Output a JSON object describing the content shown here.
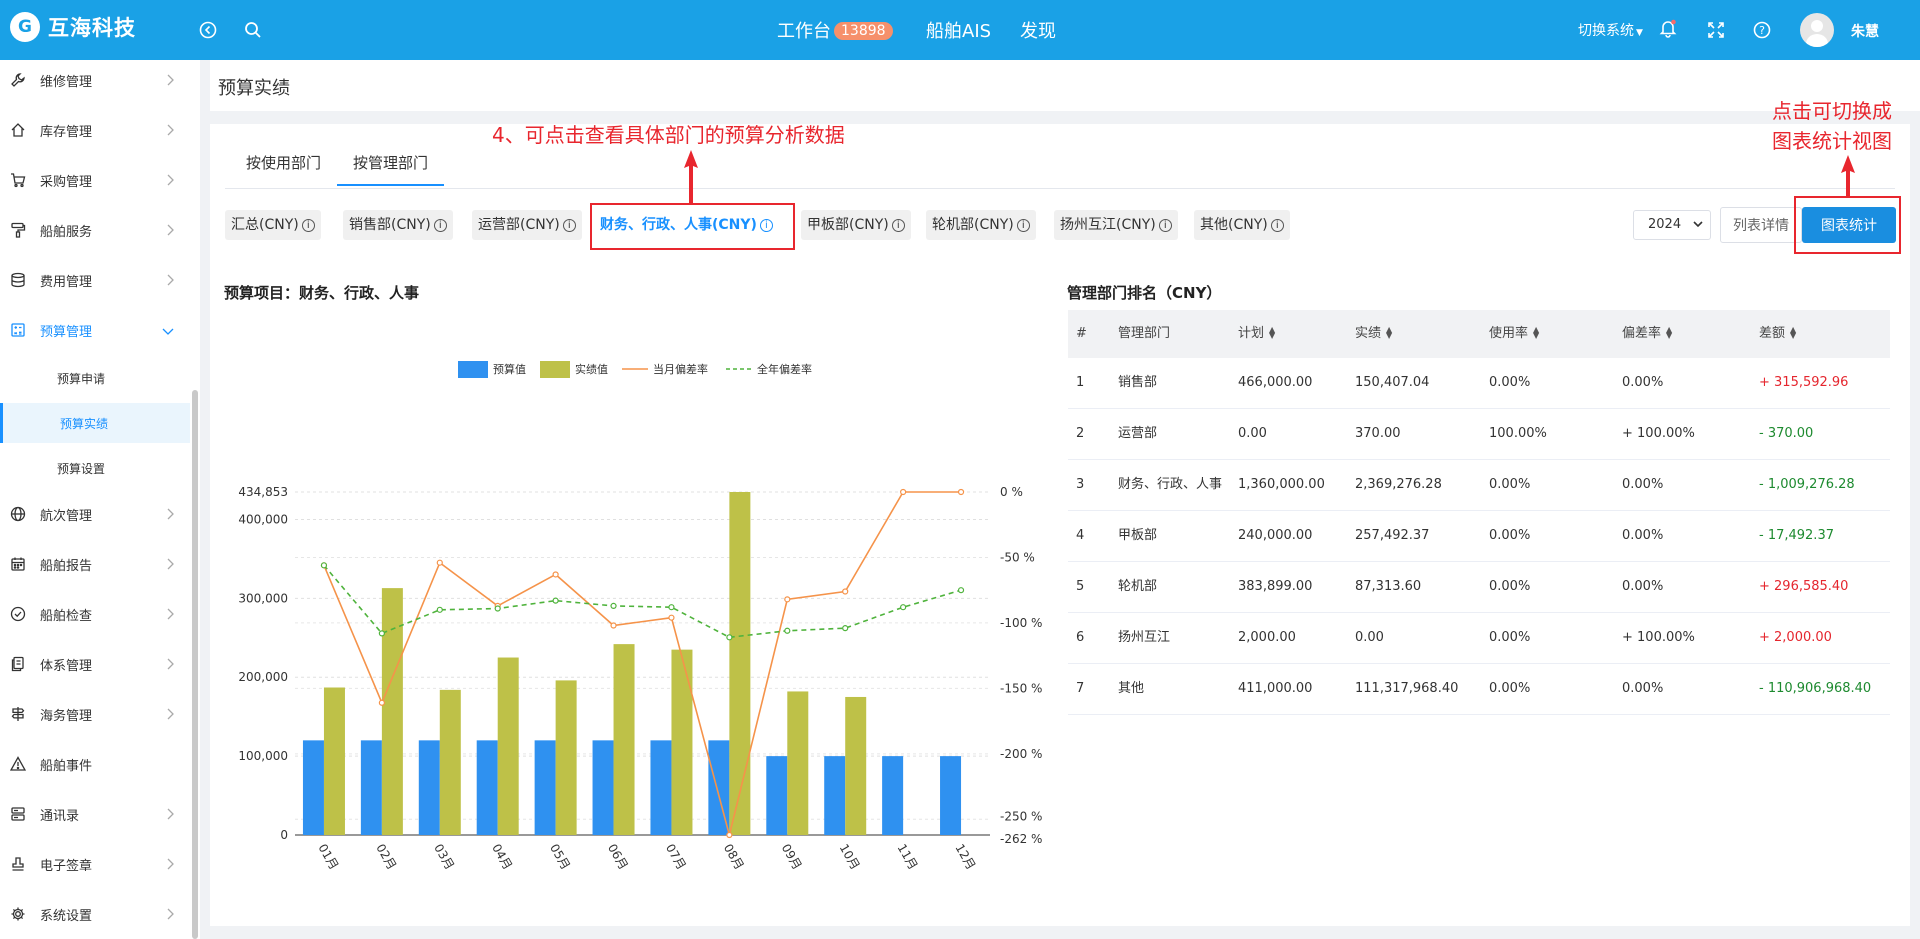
{
  "header": {
    "logo_mark": "G",
    "brand": "互海科技",
    "nav": [
      {
        "label": "工作台",
        "badge": "13898"
      },
      {
        "label": "船舶AIS"
      },
      {
        "label": "发现"
      }
    ],
    "switch_label": "切换系统",
    "user_name": "朱慧"
  },
  "sidebar": {
    "items": [
      {
        "label": "维修管理",
        "icon": "wrench-icon"
      },
      {
        "label": "库存管理",
        "icon": "home-icon"
      },
      {
        "label": "采购管理",
        "icon": "cart-icon"
      },
      {
        "label": "船舶服务",
        "icon": "paint-roller-icon"
      },
      {
        "label": "费用管理",
        "icon": "database-icon"
      },
      {
        "label": "预算管理",
        "icon": "calculator-icon"
      },
      {
        "label": "航次管理",
        "icon": "globe-icon"
      },
      {
        "label": "船舶报告",
        "icon": "calendar-icon"
      },
      {
        "label": "船舶检查",
        "icon": "check-circle-icon"
      },
      {
        "label": "体系管理",
        "icon": "document-icon"
      },
      {
        "label": "海务管理",
        "icon": "signpost-icon"
      },
      {
        "label": "船舶事件",
        "icon": "warning-icon"
      },
      {
        "label": "通讯录",
        "icon": "server-icon"
      },
      {
        "label": "电子签章",
        "icon": "stamp-icon"
      },
      {
        "label": "系统设置",
        "icon": "gear-icon"
      }
    ],
    "budget_sub": [
      "预算申请",
      "预算实绩",
      "预算设置"
    ]
  },
  "page_title": "预算实绩",
  "tabs": [
    "按使用部门",
    "按管理部门"
  ],
  "pills": [
    "汇总(CNY)",
    "销售部(CNY)",
    "运营部(CNY)",
    "财务、行政、人事(CNY)",
    "甲板部(CNY)",
    "轮机部(CNY)",
    "扬州互江(CNY)",
    "其他(CNY)"
  ],
  "year": "2024",
  "list_button": "列表详情",
  "chart_button": "图表统计",
  "chart_title": "预算项目：财务、行政、人事",
  "chart_data": {
    "type": "bar",
    "categories": [
      "01月",
      "02月",
      "03月",
      "04月",
      "05月",
      "06月",
      "07月",
      "08月",
      "09月",
      "10月",
      "11月",
      "12月"
    ],
    "series": [
      {
        "name": "预算值",
        "type": "bar",
        "color": "#2f91f0",
        "values": [
          120000,
          120000,
          120000,
          120000,
          120000,
          120000,
          120000,
          120000,
          100000,
          100000,
          100000,
          100000
        ]
      },
      {
        "name": "实绩值",
        "type": "bar",
        "color": "#bec148",
        "values": [
          187000,
          313000,
          184000,
          225000,
          196000,
          242000,
          235000,
          434853,
          182000,
          175000,
          0,
          0
        ]
      },
      {
        "name": "当月偏差率",
        "type": "line",
        "color": "#f5934a",
        "axis": "right",
        "values": [
          -56,
          -161,
          -54,
          -87,
          -63,
          -102,
          -96,
          -262,
          -82,
          -76,
          0,
          0
        ]
      },
      {
        "name": "全年偏差率",
        "type": "dashed-line",
        "color": "#4fb33c",
        "axis": "right",
        "values": [
          -56,
          -108,
          -90,
          -89,
          -83,
          -87,
          -88,
          -111,
          -106,
          -104,
          -88,
          -75
        ]
      }
    ],
    "left_axis": {
      "min": 0,
      "max": 434853,
      "ticks": [
        "0",
        "100,000",
        "200,000",
        "300,000",
        "400,000",
        "434,853"
      ]
    },
    "right_axis": {
      "min": -262,
      "max": 0,
      "ticks": [
        "-262 %",
        "-250 %",
        "-200 %",
        "-150 %",
        "-100 %",
        "-50 %",
        "0 %"
      ]
    },
    "grid": true,
    "legend_position": "top"
  },
  "table": {
    "title": "管理部门排名（CNY）",
    "headers": [
      "#",
      "管理部门",
      "计划",
      "实绩",
      "使用率",
      "偏差率",
      "差额"
    ],
    "rows": [
      {
        "no": "1",
        "dept": "销售部",
        "plan": "466,000.00",
        "actual": "150,407.04",
        "usage": "0.00%",
        "dev": "0.00%",
        "diff": "+ 315,592.96",
        "sign": "pos"
      },
      {
        "no": "2",
        "dept": "运营部",
        "plan": "0.00",
        "actual": "370.00",
        "usage": "100.00%",
        "dev": "+ 100.00%",
        "diff": "- 370.00",
        "sign": "neg"
      },
      {
        "no": "3",
        "dept": "财务、行政、人事",
        "plan": "1,360,000.00",
        "actual": "2,369,276.28",
        "usage": "0.00%",
        "dev": "0.00%",
        "diff": "- 1,009,276.28",
        "sign": "neg"
      },
      {
        "no": "4",
        "dept": "甲板部",
        "plan": "240,000.00",
        "actual": "257,492.37",
        "usage": "0.00%",
        "dev": "0.00%",
        "diff": "- 17,492.37",
        "sign": "neg"
      },
      {
        "no": "5",
        "dept": "轮机部",
        "plan": "383,899.00",
        "actual": "87,313.60",
        "usage": "0.00%",
        "dev": "0.00%",
        "diff": "+ 296,585.40",
        "sign": "pos"
      },
      {
        "no": "6",
        "dept": "扬州互江",
        "plan": "2,000.00",
        "actual": "0.00",
        "usage": "0.00%",
        "dev": "+ 100.00%",
        "diff": "+ 2,000.00",
        "sign": "pos"
      },
      {
        "no": "7",
        "dept": "其他",
        "plan": "411,000.00",
        "actual": "111,317,968.40",
        "usage": "0.00%",
        "dev": "0.00%",
        "diff": "- 110,906,968.40",
        "sign": "neg"
      }
    ]
  },
  "annotations": {
    "department_hint": "4、可点击查看具体部门的预算分析数据",
    "switch_hint_1": "点击可切换成",
    "switch_hint_2": "图表统计视图"
  },
  "colors": {
    "header": "#1aa1e6",
    "primary": "#1890ff",
    "annotation": "#e8262e",
    "positive": "#e5262e",
    "negative": "#1d8a2f"
  }
}
